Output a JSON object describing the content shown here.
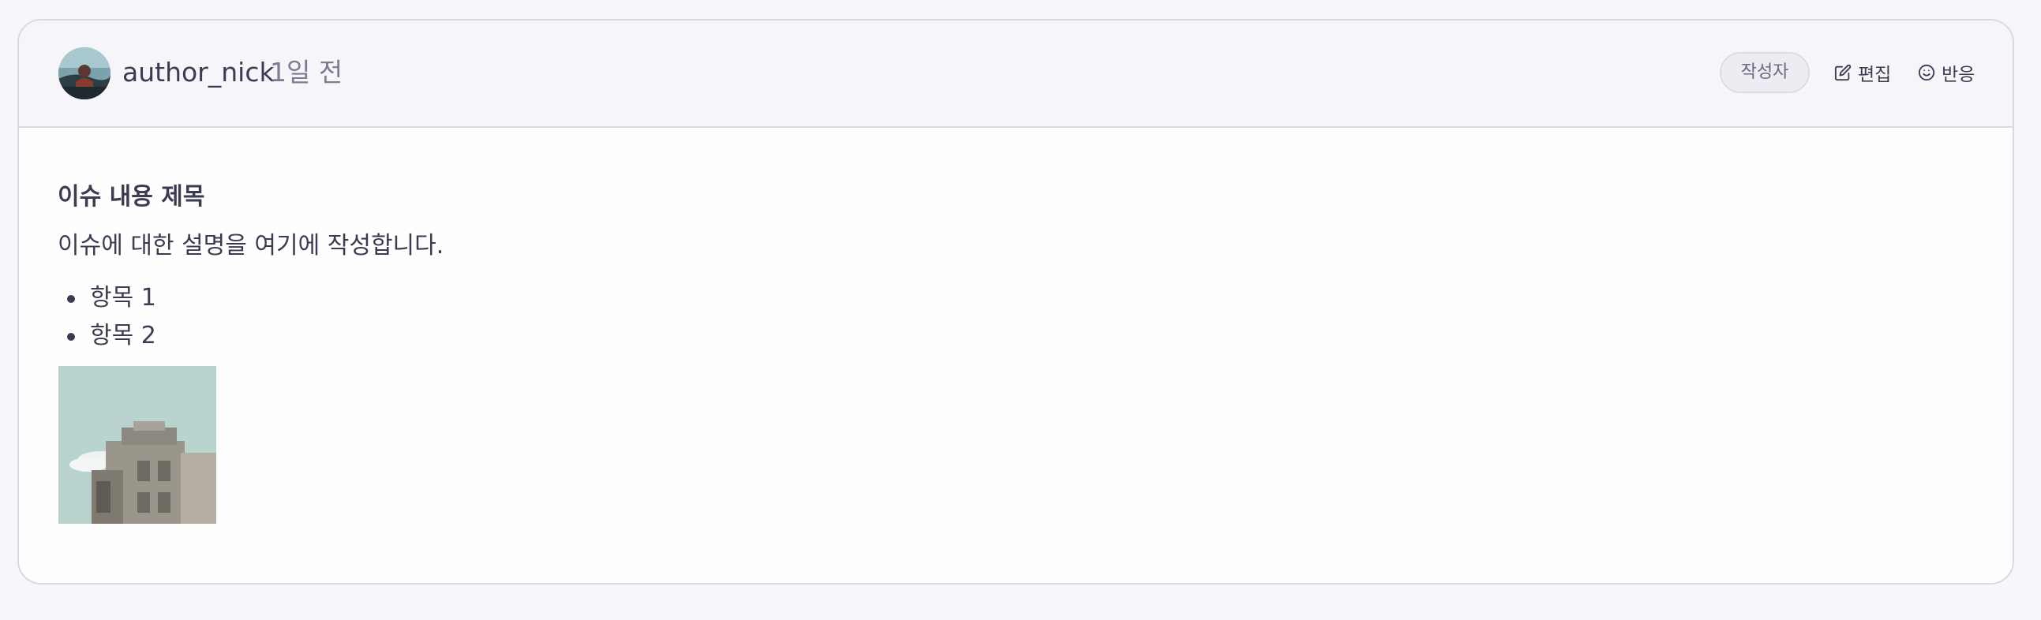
{
  "comment": {
    "author": "author_nick",
    "time_ago": "1일 전",
    "badge": "작성자",
    "actions": {
      "edit_label": "편집",
      "edit_icon": "pencil-square-icon",
      "react_label": "반응",
      "react_icon": "smile-face-icon"
    },
    "avatar_icon": "user-avatar-photo",
    "body": {
      "title": "이슈 내용 제목",
      "description": "이슈에 대한 설명을 여기에 작성합니다.",
      "list_items": [
        "항목 1",
        "항목 2"
      ],
      "image_icon": "building-photo"
    }
  },
  "colors": {
    "page_bg": "#f7f7fb",
    "header_bg": "#f6f6fa",
    "border": "#d9d9e6",
    "text": "#3b3b52",
    "muted_text": "#7c7c92"
  }
}
